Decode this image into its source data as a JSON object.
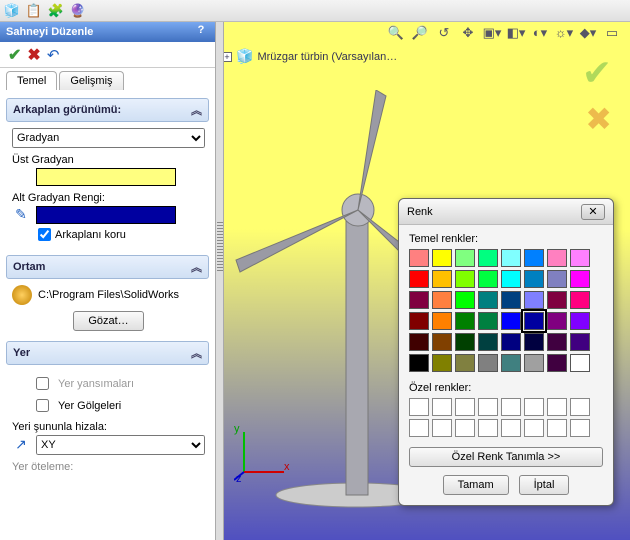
{
  "top_icons": [
    "🧊",
    "📋",
    "🧩",
    "🔮"
  ],
  "panel_title": "Sahneyi Düzenle",
  "tabs": {
    "t0": "Temel",
    "t1": "Gelişmiş"
  },
  "bg": {
    "head": "Arkaplan görünümü:",
    "type_options": [
      "Gradyan"
    ],
    "type_selected": "Gradyan",
    "top_label": "Üst Gradyan",
    "top_color": "#ffff80",
    "bot_label": "Alt Gradyan Rengi:",
    "bot_color": "#0000a0",
    "keep_bg": "Arkaplanı koru",
    "keep_bg_checked": true
  },
  "env": {
    "head": "Ortam",
    "path": "C:\\Program Files\\SolidWorks",
    "browse": "Gözat…"
  },
  "floor": {
    "head": "Yer",
    "reflections": "Yer yansımaları",
    "reflections_checked": false,
    "shadows": "Yer Gölgeleri",
    "shadows_checked": false,
    "align_label": "Yeri şununla hizala:",
    "align_options": [
      "XY"
    ],
    "align_selected": "XY",
    "offset_label": "Yer öteleme:"
  },
  "tree_item": "Mrüzgar türbin  (Varsayılan…",
  "color_dlg": {
    "title": "Renk",
    "basic_label": "Temel renkler:",
    "basic_colors": [
      "#ff8080",
      "#ffff00",
      "#80ff80",
      "#00ff80",
      "#80ffff",
      "#0080ff",
      "#ff80c0",
      "#ff80ff",
      "#ff0000",
      "#ffc000",
      "#80ff00",
      "#00ff40",
      "#00ffff",
      "#0080c0",
      "#8080c0",
      "#ff00ff",
      "#800040",
      "#ff8040",
      "#00ff00",
      "#008080",
      "#004080",
      "#8080ff",
      "#800040",
      "#ff0080",
      "#800000",
      "#ff8000",
      "#008000",
      "#008040",
      "#0000ff",
      "#0000a0",
      "#800080",
      "#8000ff",
      "#400000",
      "#804000",
      "#004000",
      "#004040",
      "#000080",
      "#000040",
      "#400040",
      "#400080",
      "#000000",
      "#808000",
      "#808040",
      "#808080",
      "#408080",
      "#a0a0a0",
      "#400040",
      "#ffffff"
    ],
    "selected_index": 29,
    "custom_label": "Özel renkler:",
    "define_btn": "Özel Renk Tanımla >>",
    "ok": "Tamam",
    "cancel": "İptal"
  }
}
